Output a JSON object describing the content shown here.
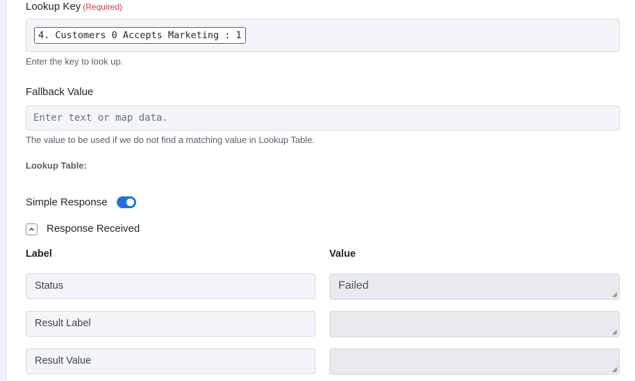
{
  "lookup_key": {
    "label": "Lookup Key",
    "required": "(Required)",
    "token": "4. Customers 0 Accepts Marketing : 1",
    "help": "Enter the key to look up."
  },
  "fallback": {
    "label": "Fallback Value",
    "placeholder": "Enter text or map data.",
    "help": "The value to be used if we do not find a matching value in Lookup Table."
  },
  "lookup_table_label": "Lookup Table:",
  "simple_response": {
    "label": "Simple Response",
    "enabled": true
  },
  "response_received": {
    "label": "Response Received",
    "expanded": true
  },
  "table": {
    "label_header": "Label",
    "value_header": "Value",
    "rows": [
      {
        "label": "Status",
        "value": "Failed"
      },
      {
        "label": "Result Label",
        "value": ""
      },
      {
        "label": "Result Value",
        "value": ""
      }
    ]
  },
  "colors": {
    "accent": "#1c74d9",
    "required": "#d0383f"
  }
}
